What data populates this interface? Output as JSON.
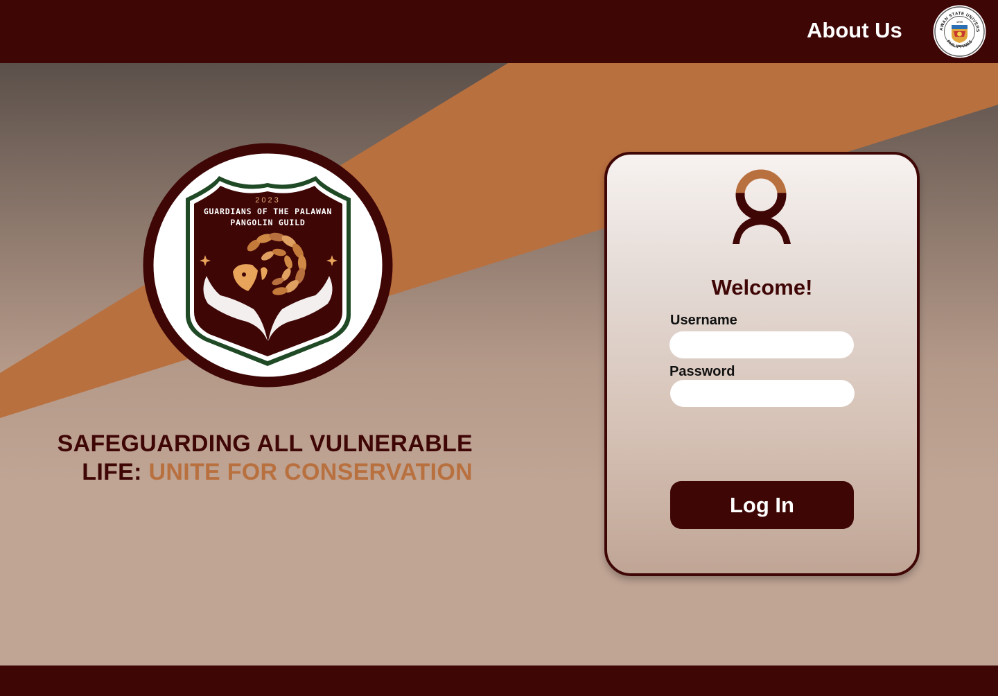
{
  "header": {
    "about_label": "About Us",
    "seal": {
      "name": "Palawan State University seal",
      "text_top": "PALAWAN STATE UNIVERSITY",
      "text_bottom": "PHILIPPINES",
      "year": "1965"
    }
  },
  "hero": {
    "logo": {
      "year": "2023",
      "line1": "GUARDIANS OF THE PALAWAN",
      "line2": "PANGOLIN GUILD"
    },
    "tagline": {
      "part1": "SAFEGUARDING ALL VULNERABLE",
      "part2": "LIFE:",
      "accent": "UNITE FOR CONSERVATION"
    }
  },
  "login": {
    "welcome": "Welcome!",
    "username_label": "Username",
    "username_value": "",
    "password_label": "Password",
    "password_value": "",
    "button_label": "Log In"
  },
  "colors": {
    "brand_dark": "#3f0606",
    "accent_orange": "#b9703f",
    "shield_green": "#1f4a25"
  }
}
